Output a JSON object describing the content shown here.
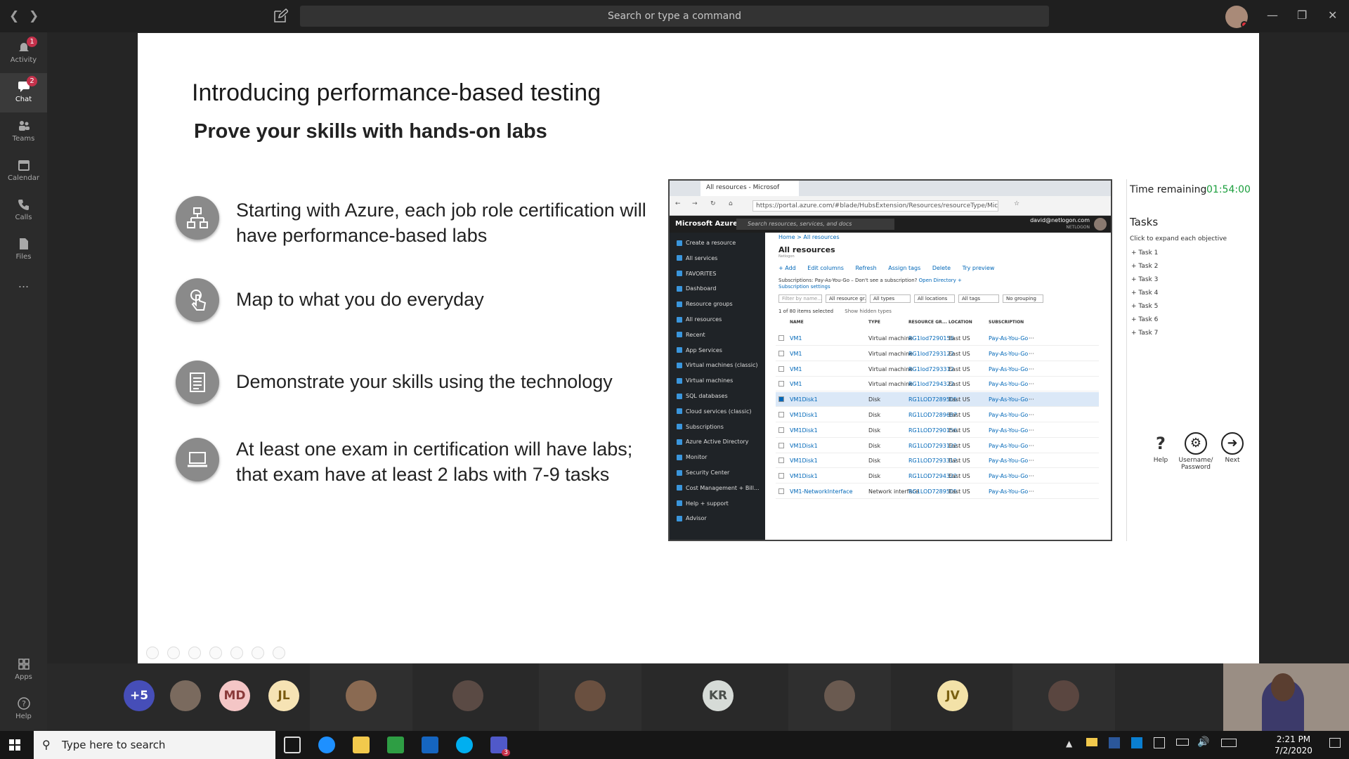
{
  "topbar": {
    "search_placeholder": "Search or type a command",
    "back_icon": "chevron-left-icon",
    "forward_icon": "chevron-right-icon",
    "compose_icon": "compose-icon",
    "window_controls": [
      "minimize",
      "restore",
      "close"
    ]
  },
  "rail": {
    "items": [
      {
        "label": "Activity",
        "icon": "bell-icon",
        "badge": "1"
      },
      {
        "label": "Chat",
        "icon": "chat-icon",
        "badge": "2",
        "active": true
      },
      {
        "label": "Teams",
        "icon": "teams-icon"
      },
      {
        "label": "Calendar",
        "icon": "calendar-icon"
      },
      {
        "label": "Calls",
        "icon": "phone-icon"
      },
      {
        "label": "Files",
        "icon": "file-icon"
      },
      {
        "label": "...",
        "icon": "more-icon"
      }
    ],
    "bottom": [
      {
        "label": "Apps",
        "icon": "apps-icon"
      },
      {
        "label": "Help",
        "icon": "help-icon"
      }
    ]
  },
  "slide": {
    "title": "Introducing performance-based testing",
    "subtitle": "Prove your skills with hands-on labs",
    "bullets": [
      {
        "icon": "hierarchy-icon",
        "text": "Starting with Azure, each job role certification will have performance-based labs"
      },
      {
        "icon": "touch-icon",
        "text": "Map to what you do everyday"
      },
      {
        "icon": "document-icon",
        "text": "Demonstrate your skills using the technology"
      },
      {
        "icon": "laptop-icon",
        "text": "At least one exam in certification will have labs; that exam have at least 2 labs with 7-9 tasks"
      }
    ]
  },
  "shot": {
    "tab_title": "All resources - Microsof",
    "url": "https://portal.azure.com/#blade/HubsExtension/Resources/resourceType/Microsoft.Resourc",
    "portal_name": "Microsoft Azure",
    "search_placeholder": "Search resources, services, and docs",
    "user_email": "david@netlogon.com",
    "user_org": "NETLOGON",
    "nav": [
      "Create a resource",
      "All services",
      "FAVORITES",
      "Dashboard",
      "Resource groups",
      "All resources",
      "Recent",
      "App Services",
      "Virtual machines (classic)",
      "Virtual machines",
      "SQL databases",
      "Cloud services (classic)",
      "Subscriptions",
      "Azure Active Directory",
      "Monitor",
      "Security Center",
      "Cost Management + Bill...",
      "Help + support",
      "Advisor"
    ],
    "breadcrumb": "Home > All resources",
    "blade_title": "All resources",
    "blade_sub": "Netlogon",
    "toolbar": [
      "+ Add",
      "Edit columns",
      "Refresh",
      "Assign tags",
      "Delete",
      "Try preview"
    ],
    "subscriptions_text": "Subscriptions: Pay-As-You-Go – Don't see a subscription?",
    "subscriptions_link": "Open Directory + Subscription settings",
    "filters": [
      "Filter by name...",
      "All resource gr...",
      "All types",
      "All locations",
      "All tags",
      "No grouping"
    ],
    "selected_count": "1 of 80 items selected",
    "show_hidden": "Show hidden types",
    "columns": [
      "NAME",
      "TYPE",
      "RESOURCE GR...",
      "LOCATION",
      "SUBSCRIPTION"
    ],
    "rows": [
      {
        "name": "VM1",
        "type": "Virtual machine",
        "rg": "RG1lod7290156",
        "loc": "East US",
        "sub": "Pay-As-You-Go"
      },
      {
        "name": "VM1",
        "type": "Virtual machine",
        "rg": "RG1lod7293122",
        "loc": "East US",
        "sub": "Pay-As-You-Go"
      },
      {
        "name": "VM1",
        "type": "Virtual machine",
        "rg": "RG1lod7293312",
        "loc": "East US",
        "sub": "Pay-As-You-Go"
      },
      {
        "name": "VM1",
        "type": "Virtual machine",
        "rg": "RG1lod7294322",
        "loc": "East US",
        "sub": "Pay-As-You-Go"
      },
      {
        "name": "VM1Disk1",
        "type": "Disk",
        "rg": "RG1LOD7289505",
        "loc": "East US",
        "sub": "Pay-As-You-Go",
        "selected": true
      },
      {
        "name": "VM1Disk1",
        "type": "Disk",
        "rg": "RG1LOD7289687",
        "loc": "East US",
        "sub": "Pay-As-You-Go"
      },
      {
        "name": "VM1Disk1",
        "type": "Disk",
        "rg": "RG1LOD7290156",
        "loc": "East US",
        "sub": "Pay-As-You-Go"
      },
      {
        "name": "VM1Disk1",
        "type": "Disk",
        "rg": "RG1LOD7293122",
        "loc": "East US",
        "sub": "Pay-As-You-Go"
      },
      {
        "name": "VM1Disk1",
        "type": "Disk",
        "rg": "RG1LOD7293312",
        "loc": "East US",
        "sub": "Pay-As-You-Go"
      },
      {
        "name": "VM1Disk1",
        "type": "Disk",
        "rg": "RG1LOD7294322",
        "loc": "East US",
        "sub": "Pay-As-You-Go"
      },
      {
        "name": "VM1-NetworkInterface",
        "type": "Network interface",
        "rg": "RG1LOD7289505",
        "loc": "East US",
        "sub": "Pay-As-You-Go"
      }
    ]
  },
  "tasks": {
    "time_label": "Time remaining",
    "time_value": "01:54:00",
    "heading": "Tasks",
    "hint": "Click to expand each objective",
    "items": [
      "+ Task 1",
      "+ Task 2",
      "+ Task 3",
      "+ Task 4",
      "+ Task 5",
      "+ Task 6",
      "+ Task 7"
    ],
    "buttons": [
      {
        "label": "Help",
        "icon": "question-icon"
      },
      {
        "label": "Username/ Password",
        "icon": "gear-icon"
      },
      {
        "label": "Next",
        "icon": "arrow-right-icon"
      }
    ]
  },
  "participants": [
    {
      "initials": "+5",
      "color": "#464eb8",
      "fg": "#ffffff"
    },
    {
      "initials": "",
      "color": "#7a6a5e",
      "photo": true
    },
    {
      "initials": "MD",
      "color": "#f4c6c6",
      "fg": "#8a3a3a"
    },
    {
      "initials": "JL",
      "color": "#f6e3b4",
      "fg": "#7a5a10"
    },
    {
      "initials": "",
      "color": "#8a6a52",
      "photo": true
    },
    {
      "initials": "",
      "color": "#5a4a44",
      "photo": true
    },
    {
      "initials": "",
      "color": "#6a5040",
      "photo": true
    },
    {
      "initials": "KR",
      "color": "#d6dbd7",
      "fg": "#4a4f4b"
    },
    {
      "initials": "",
      "color": "#6a5a50",
      "photo": true
    },
    {
      "initials": "JV",
      "color": "#f3e2a8",
      "fg": "#7a6010"
    },
    {
      "initials": "",
      "color": "#5a4640",
      "photo": true
    }
  ],
  "taskbar": {
    "search_placeholder": "Type here to search",
    "time": "2:21 PM",
    "date": "7/2/2020",
    "teams_badge": "3"
  },
  "colors": {
    "rail_bg": "#2b2b2b",
    "badge": "#c4314b",
    "timer": "#1a9e3c",
    "azure_link": "#0067b8"
  }
}
